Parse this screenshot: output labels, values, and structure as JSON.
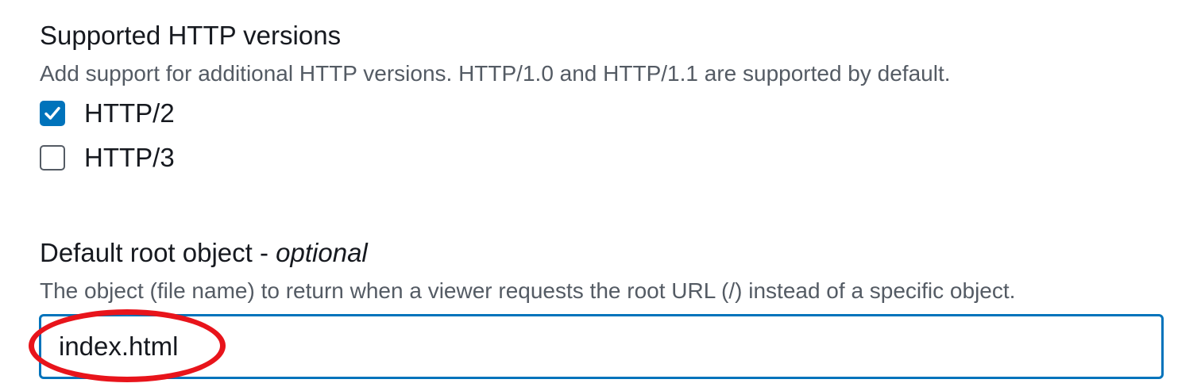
{
  "http_versions": {
    "label": "Supported HTTP versions",
    "description": "Add support for additional HTTP versions. HTTP/1.0 and HTTP/1.1 are supported by default.",
    "options": [
      {
        "label": "HTTP/2",
        "checked": true
      },
      {
        "label": "HTTP/3",
        "checked": false
      }
    ]
  },
  "default_root_object": {
    "label": "Default root object - ",
    "label_optional": "optional",
    "description": "The object (file name) to return when a viewer requests the root URL (/) instead of a specific object.",
    "value": "index.html"
  },
  "colors": {
    "accent": "#0073bb",
    "annotation": "#e8141b",
    "description_text": "#545b64"
  }
}
